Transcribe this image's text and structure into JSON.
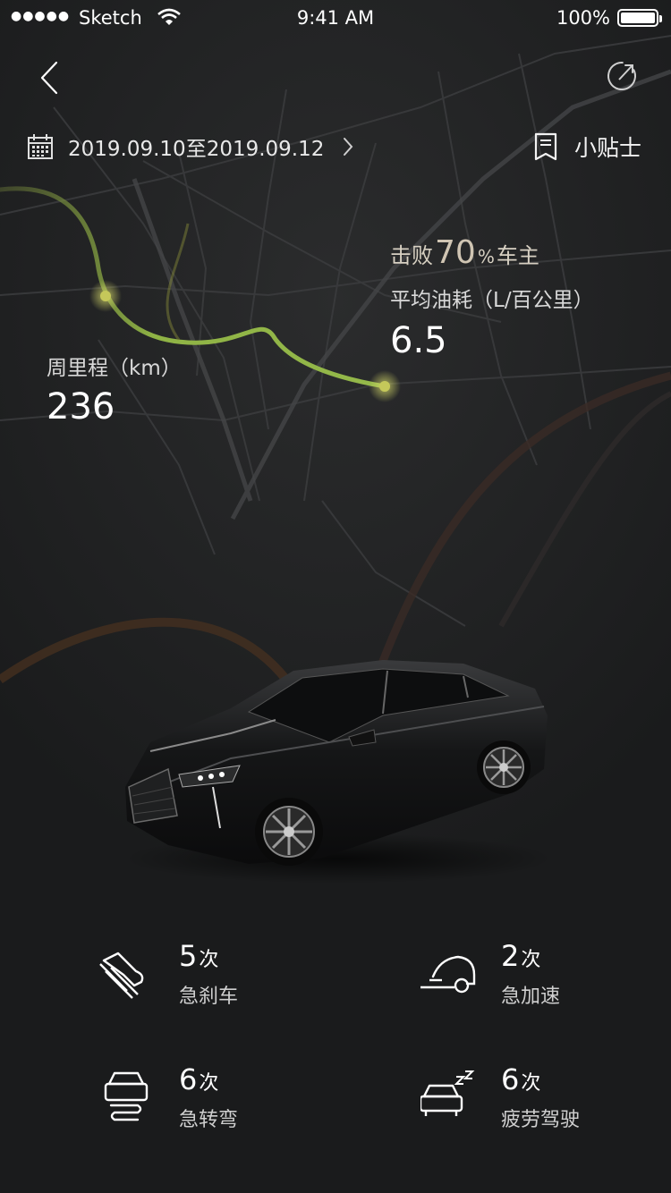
{
  "status_bar": {
    "carrier": "Sketch",
    "time": "9:41 AM",
    "battery": "100%",
    "icons": [
      "signal-dots-icon",
      "wifi-icon",
      "battery-icon"
    ]
  },
  "nav": {
    "back_icon": "chevron-left-icon",
    "refresh_icon": "refresh-icon"
  },
  "date_range": {
    "text": "2019.09.10至2019.09.12",
    "icon": "calendar-icon"
  },
  "tips": {
    "label": "小贴士",
    "icon": "document-icon"
  },
  "ranking": {
    "prefix": "击败",
    "percent": "70",
    "percent_sign": "%",
    "suffix": "车主"
  },
  "fuel": {
    "label": "平均油耗（L/百公里）",
    "value": "6.5"
  },
  "mileage": {
    "label": "周里程（km）",
    "value": "236"
  },
  "behaviors": [
    {
      "count": "5",
      "unit": "次",
      "label": "急刹车",
      "icon": "hard-brake-icon"
    },
    {
      "count": "2",
      "unit": "次",
      "label": "急加速",
      "icon": "rapid-acceleration-icon"
    },
    {
      "count": "6",
      "unit": "次",
      "label": "急转弯",
      "icon": "sharp-turn-icon"
    },
    {
      "count": "6",
      "unit": "次",
      "label": "疲劳驾驶",
      "icon": "fatigue-driving-icon"
    }
  ],
  "colors": {
    "background": "#1a1b1c",
    "route": "#8fb345",
    "route_point": "#c3c95a",
    "accent_text": "#d0c5b3"
  }
}
